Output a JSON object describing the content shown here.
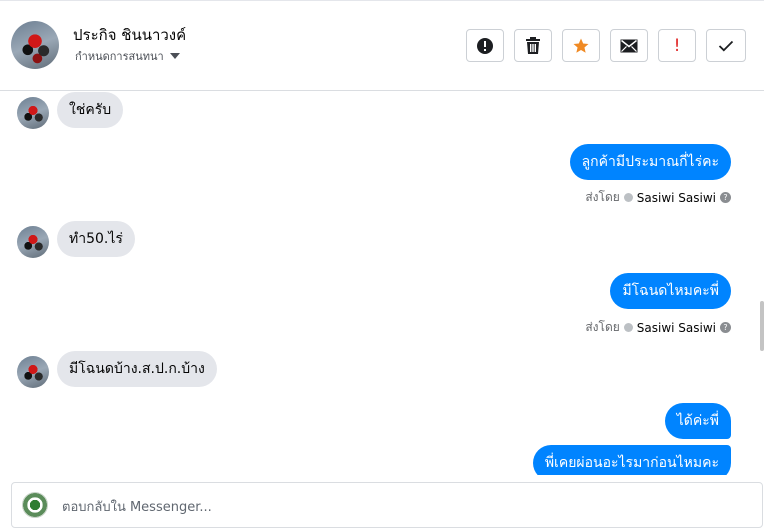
{
  "header": {
    "contact_name": "ประกิจ ชินนาวงค์",
    "conversation_settings": "กำหนดการสนทนา",
    "toolbar": {
      "spam_icon": "alert-circle-icon",
      "delete_icon": "trash-icon",
      "star_icon": "star-icon",
      "unread_icon": "envelope-icon",
      "important_icon": "exclamation-icon",
      "done_icon": "check-icon",
      "important_label": "!"
    },
    "colors": {
      "star": "#f08a24",
      "important": "#e02424"
    }
  },
  "messages": [
    {
      "direction": "in",
      "text": "ใช่ครับ"
    },
    {
      "direction": "out",
      "text": "ลูกค้ามีประมาณกี่ไร่คะ",
      "sent_by_label": "ส่งโดย",
      "sender": "Sasiwi Sasiwi"
    },
    {
      "direction": "in",
      "text": "ทำ50.ไร่"
    },
    {
      "direction": "out",
      "text": "มีโฉนดไหมคะพี่",
      "sent_by_label": "ส่งโดย",
      "sender": "Sasiwi Sasiwi"
    },
    {
      "direction": "in",
      "text": "มีโฉนดบ้าง.ส.ป.ก.บ้าง"
    },
    {
      "direction": "out",
      "text": "ได้ค่ะพี่"
    },
    {
      "direction": "out",
      "text": "พี่เคยผ่อนอะไรมาก่อนไหมคะ"
    }
  ],
  "composer": {
    "placeholder": "ตอบกลับใน Messenger..."
  },
  "bubble_colors": {
    "incoming": "#e4e6eb",
    "outgoing": "#0084ff"
  }
}
